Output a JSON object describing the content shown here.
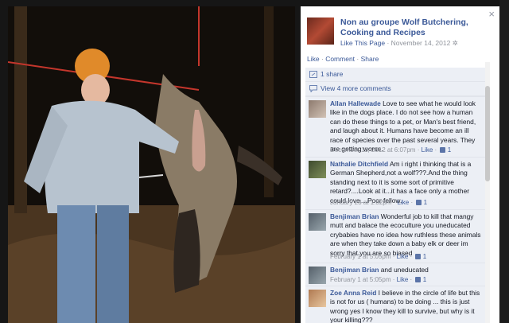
{
  "panel": {
    "close_glyph": "×",
    "page_name": "Non au groupe Wolf Butchering, Cooking and Recipes",
    "like_page": "Like This Page",
    "dot": "·",
    "post_date": "November 14, 2012",
    "actions": {
      "like": "Like",
      "comment": "Comment",
      "share": "Share",
      "sep": "·"
    },
    "shares": "1 share",
    "view_more": "View 4 more comments"
  },
  "comments": [
    {
      "author": "Allan Hallewade",
      "text": "Love to see what he would look like in the dogs place. I do not see how a human can do these things to a pet, or Man's best friend, and laugh about it. Humans have become an ill race of species over the past several years. They are getting worse.",
      "date": "December 11, 2012 at 6:07pm",
      "like": "Like",
      "likes": "1",
      "dot": "·"
    },
    {
      "author": "Nathalie Ditchfield",
      "text": "Am i right i thinking that is a German Shepherd,not a wolf???.And the thing standing next to it is some sort of primitive retard?....Look at it...it has a face only a mother could love....Poor fellow.",
      "date": "January 23 at 1:32pm",
      "like": "Like",
      "likes": "1",
      "dot": "·"
    },
    {
      "author": "Benjiman Brian",
      "text": "Wonderful job to kill that mangy mutt and balace the ecoculture you uneducated crybabies have no idea how ruthless these animals are when they take down a baby elk or deer im sorry that you are so biased",
      "date": "February 1 at 5:05pm",
      "like": "Like",
      "likes": "1",
      "dot": "·"
    },
    {
      "author": "Benjiman Brian",
      "text": "and uneducated",
      "date": "February 1 at 5:05pm",
      "like": "Like",
      "likes": "1",
      "dot": "·"
    },
    {
      "author": "Zoe Anna Reid",
      "text": "I believe in the circle of life but this is not for us ( humans) to be doing ... this is just wrong yes I know they kill to survive, but why is it your killing???",
      "date": "",
      "like": "",
      "likes": "",
      "dot": ""
    }
  ]
}
